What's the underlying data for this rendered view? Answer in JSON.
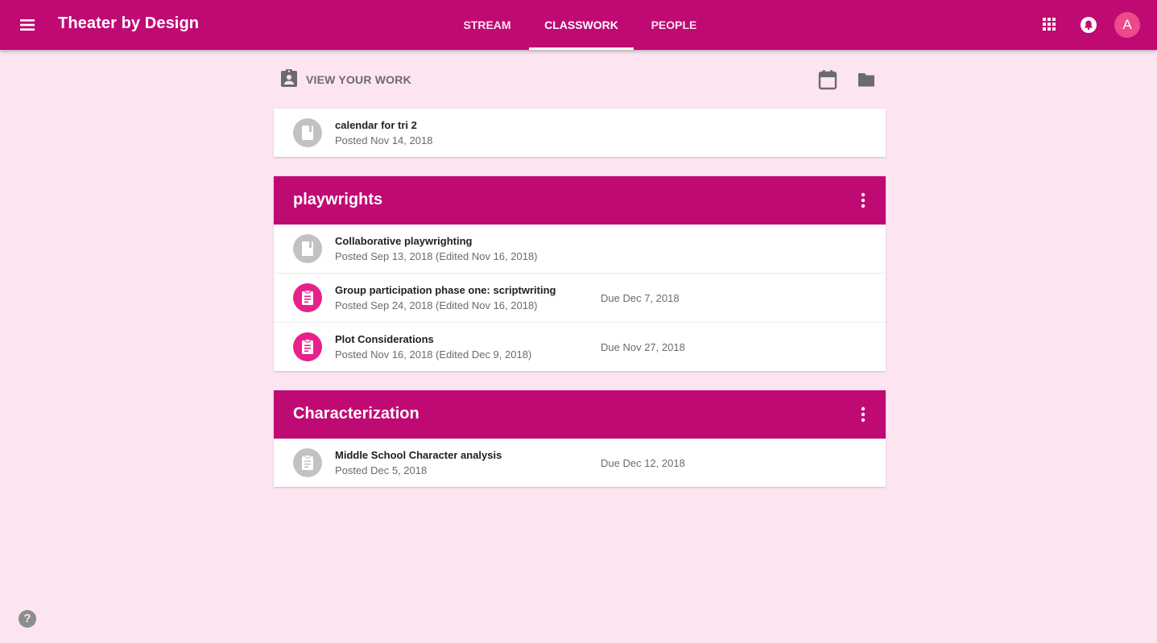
{
  "app": {
    "title": "Theater by Design"
  },
  "tabs": [
    {
      "label": "STREAM",
      "active": false
    },
    {
      "label": "CLASSWORK",
      "active": true
    },
    {
      "label": "PEOPLE",
      "active": false
    }
  ],
  "header_icons": [
    "menu-icon",
    "apps-grid-icon",
    "notifications-icon",
    "calendar-icon",
    "folder-icon"
  ],
  "user": {
    "avatar_initial": "A"
  },
  "toolbar": {
    "view_work_label": "VIEW YOUR WORK"
  },
  "colors": {
    "primary": "#bf0a73",
    "background": "#fce4f1",
    "assignment_icon": "#e8208a",
    "material_icon": "#c2c2c2"
  },
  "standalone": {
    "items": [
      {
        "title": "calendar for tri 2",
        "posted": "Posted Nov 14, 2018",
        "due": "",
        "icon": "material-icon"
      }
    ]
  },
  "topics": [
    {
      "title": "playwrights",
      "items": [
        {
          "title": "Collaborative playwrighting",
          "posted": "Posted Sep 13, 2018 (Edited Nov 16, 2018)",
          "due": "",
          "icon": "material-icon"
        },
        {
          "title": "Group participation phase one: scriptwriting",
          "posted": "Posted Sep 24, 2018 (Edited Nov 16, 2018)",
          "due": "Due Dec 7, 2018",
          "icon": "assignment-icon"
        },
        {
          "title": "Plot Considerations",
          "posted": "Posted Nov 16, 2018 (Edited Dec 9, 2018)",
          "due": "Due Nov 27, 2018",
          "icon": "assignment-icon"
        }
      ]
    },
    {
      "title": "Characterization",
      "items": [
        {
          "title": "Middle School Character analysis",
          "posted": "Posted Dec 5, 2018",
          "due": "Due Dec 12, 2018",
          "icon": "assignment-icon-inactive"
        }
      ]
    }
  ],
  "help": {
    "label": "?"
  }
}
